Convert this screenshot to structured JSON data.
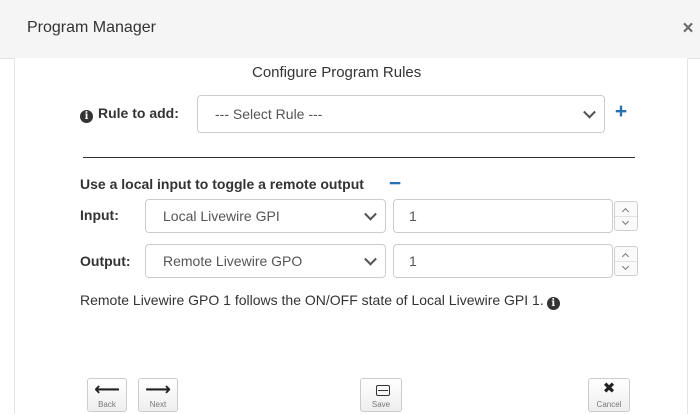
{
  "window": {
    "title": "Program Manager",
    "close_glyph": "×"
  },
  "dialog": {
    "heading": "Configure Program Rules"
  },
  "rule": {
    "label": "Rule to add:",
    "select_value": "--- Select Rule ---",
    "add_glyph": "+",
    "info_glyph": "i"
  },
  "section": {
    "title": "Use a local input to toggle a remote output",
    "collapse_glyph": "−",
    "input": {
      "label": "Input:",
      "select_value": "Local Livewire GPI",
      "number": "1"
    },
    "output": {
      "label": "Output:",
      "select_value": "Remote Livewire GPO",
      "number": "1"
    },
    "description": "Remote Livewire GPO 1 follows the ON/OFF state of Local Livewire GPI 1."
  },
  "footer": {
    "back": {
      "glyph": "⟵",
      "label": "Back"
    },
    "next": {
      "glyph": "⟶",
      "label": "Next"
    },
    "save": {
      "label": "Save"
    },
    "cancel": {
      "glyph": "✖",
      "label": "Cancel"
    }
  },
  "colors": {
    "accent": "#2a6fae",
    "title_bar": "#f5f5f5",
    "text": "#333333",
    "border": "#cccccc"
  },
  "icons": {
    "close": "close-icon",
    "info": "info-icon",
    "add": "plus-icon",
    "collapse": "minus-icon",
    "back": "arrow-left-icon",
    "next": "arrow-right-icon",
    "save": "save-icon",
    "cancel": "close-icon"
  }
}
